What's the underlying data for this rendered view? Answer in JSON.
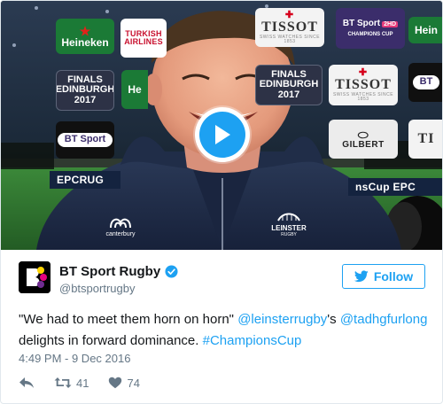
{
  "colors": {
    "twitter_blue": "#1da1f2",
    "text_primary": "#14171a",
    "text_secondary": "#657786",
    "border": "#e1e8ed"
  },
  "video": {
    "boards": {
      "heineken": "Heineken",
      "turkish": "TURKISH AIRLINES",
      "tissot": "TISSOT",
      "tissot_tag": "SWISS WATCHES SINCE 1853",
      "finals_1": "FINALS",
      "finals_2": "EDINBURGH",
      "finals_3": "2017",
      "bt": "BT Sport",
      "bt_hd": "2HD",
      "champions": "CHAMPIONS CUP",
      "gilbert": "GILBERT",
      "hein_right": "Hein",
      "ti": "TI",
      "epcr_left": "EPCRUG",
      "epcr_right": "nsCup   EPC",
      "bt_pill": "BT Sport",
      "bt_right": "BT",
      "he": "He"
    },
    "jacket_logos": {
      "canterbury": "canterbury",
      "leinster": "LEINSTER",
      "leinster_sub": "RUGBY"
    },
    "play_icon": "play-icon"
  },
  "author": {
    "display_name": "BT Sport Rugby",
    "handle": "@btsportrugby",
    "verified_icon": "verified-badge-icon"
  },
  "follow": {
    "label": "Follow",
    "icon": "twitter-bird-icon"
  },
  "tweet": {
    "part1": "\"We had to meet them horn on horn\" ",
    "mention1": "@leinsterrugby",
    "part2": "'s ",
    "mention2": "@tadhgfurlong",
    "part3": " delights in forward dominance. ",
    "hashtag": "#ChampionsCup",
    "timestamp": "4:49 PM - 9 Dec 2016"
  },
  "actions": {
    "reply_icon": "reply-icon",
    "retweet_icon": "retweet-icon",
    "retweet_count": "41",
    "like_icon": "heart-icon",
    "like_count": "74"
  }
}
